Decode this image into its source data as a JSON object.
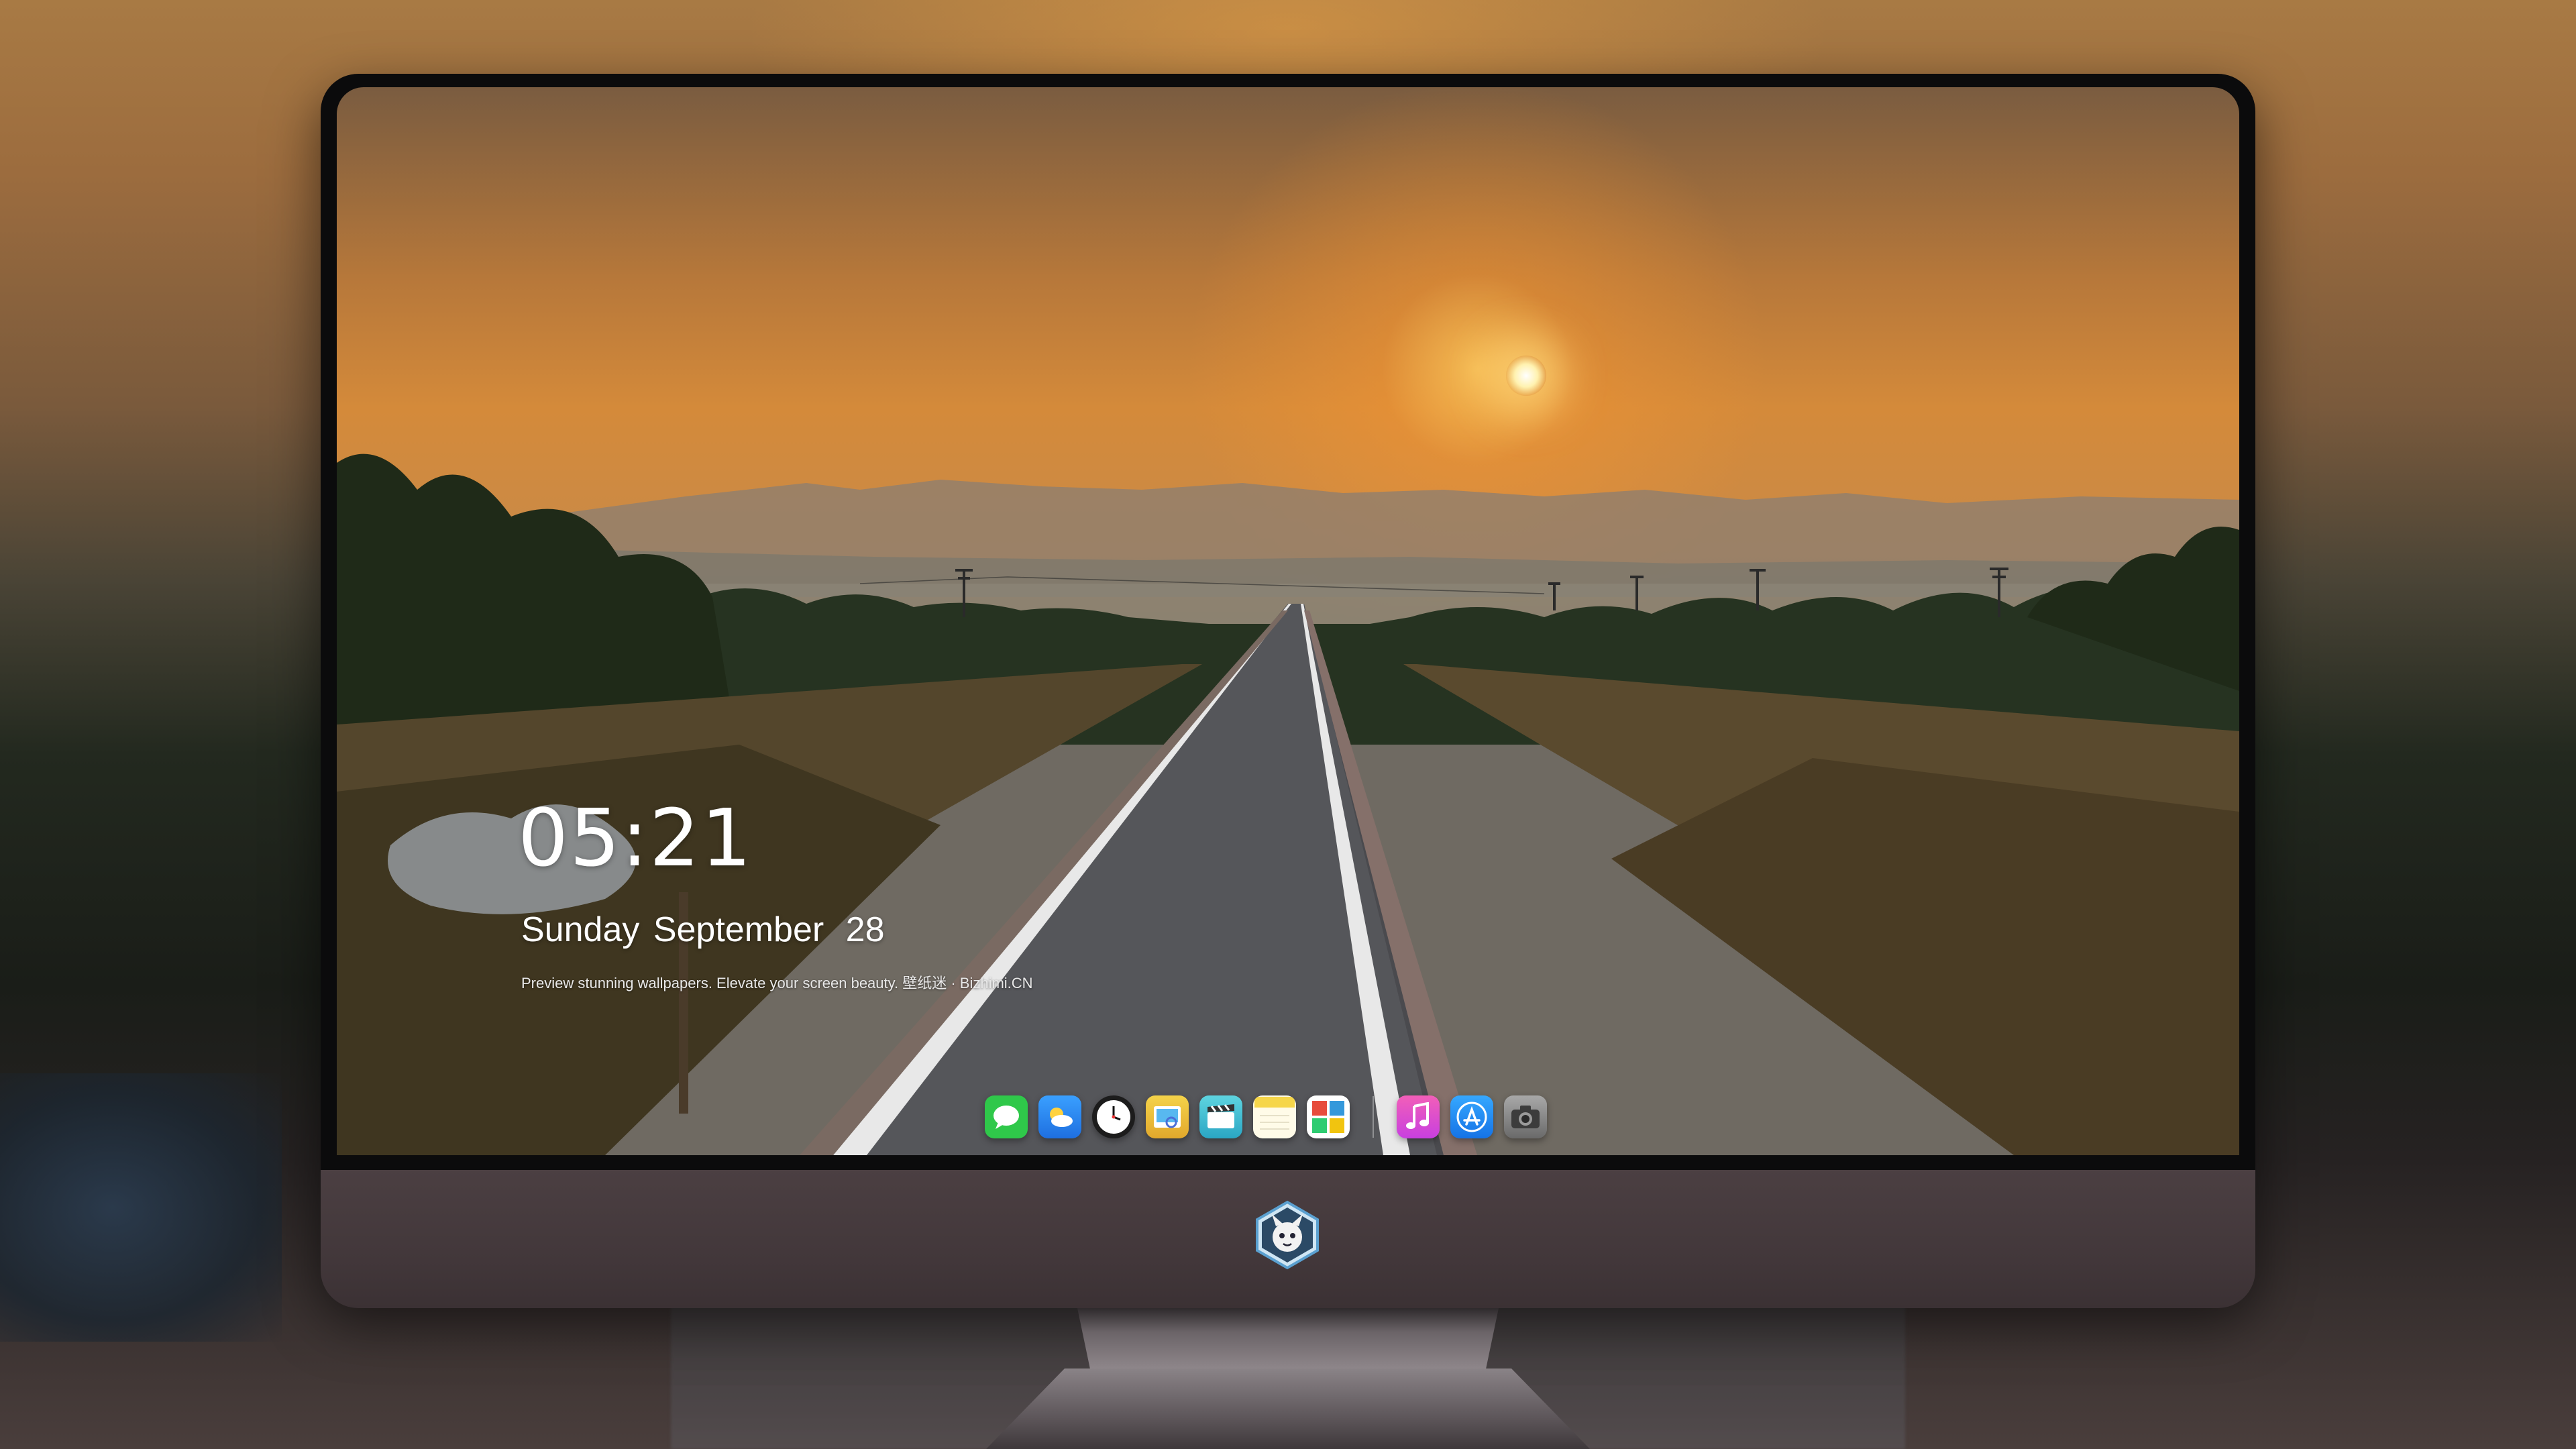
{
  "lockscreen": {
    "time": "05:21",
    "weekday": "Sunday",
    "month": "September",
    "day": "28",
    "tagline": "Preview stunning wallpapers. Elevate your screen beauty. 壁纸迷 · Bizhimi.CN"
  },
  "dock": {
    "apps": [
      {
        "name": "messages-icon",
        "color": "#2fc84a"
      },
      {
        "name": "weather-icon",
        "color": "#2a8ef0"
      },
      {
        "name": "clock-icon",
        "color": "#1c1c1c"
      },
      {
        "name": "preview-icon",
        "color": "#f0c53a"
      },
      {
        "name": "clips-icon",
        "color": "#46c6d6"
      },
      {
        "name": "notes-icon",
        "color": "#f6d64a"
      },
      {
        "name": "photo-booth-icon",
        "color": "#e74c3c"
      },
      {
        "name": "music-icon",
        "color": "#ee3fa0"
      },
      {
        "name": "app-store-icon",
        "color": "#1f8ff2"
      },
      {
        "name": "camera-icon",
        "color": "#8f8f8f"
      }
    ]
  },
  "monitor": {
    "logo": "mascot-logo-icon"
  }
}
